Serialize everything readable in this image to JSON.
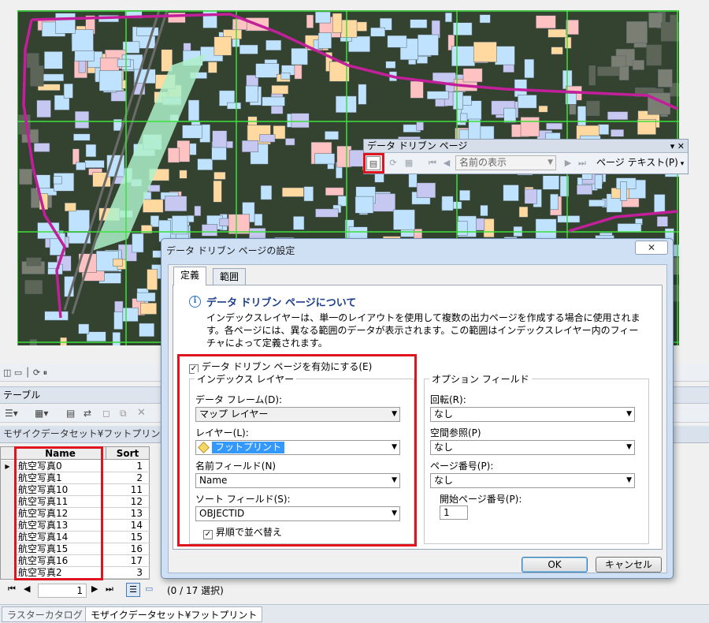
{
  "toolbar": {
    "title": "データ ドリブン ページ",
    "controls": "▾ ✕",
    "page_name_placeholder": "名前の表示",
    "page_text_label": "ページ テキスト(P)"
  },
  "table_window": {
    "title": "テーブル",
    "layer_tab": "モザイクデータセット¥フットプリン",
    "columns": [
      "Name",
      "Sort"
    ],
    "rows": [
      {
        "name": "航空写真0",
        "sort": "1"
      },
      {
        "name": "航空写真1",
        "sort": "2"
      },
      {
        "name": "航空写真10",
        "sort": "11"
      },
      {
        "name": "航空写真11",
        "sort": "12"
      },
      {
        "name": "航空写真12",
        "sort": "13"
      },
      {
        "name": "航空写真13",
        "sort": "14"
      },
      {
        "name": "航空写真14",
        "sort": "15"
      },
      {
        "name": "航空写真15",
        "sort": "16"
      },
      {
        "name": "航空写真16",
        "sort": "17"
      },
      {
        "name": "航空写真2",
        "sort": "3"
      }
    ],
    "current_record": "1",
    "selection_status": "(0 / 17 選択)",
    "bottom_tabs": [
      "ラスターカタログ",
      "モザイクデータセット¥フットプリント"
    ]
  },
  "dialog": {
    "title": "データ ドリブン ページの設定",
    "close": "✕",
    "tabs": [
      "定義",
      "範囲"
    ],
    "info_title": "データ ドリブン ページについて",
    "info_text": "インデックスレイヤーは、単一のレイアウトを使用して複数の出力ページを作成する場合に使用されます。各ページには、異なる範囲のデータが表示されます。この範囲はインデックスレイヤー内のフィーチャによって定義されます。",
    "enable_label": "データ ドリブン ページを有効にする(E)",
    "index_group": "インデックス レイヤー",
    "data_frame_label": "データ フレーム(D):",
    "data_frame_value": "マップ レイヤー",
    "layer_label": "レイヤー(L):",
    "layer_value": "フットプリント",
    "name_field_label": "名前フィールド(N)",
    "name_field_value": "Name",
    "sort_field_label": "ソート フィールド(S):",
    "sort_field_value": "OBJECTID",
    "ascending_label": "昇順で並べ替え",
    "options_group": "オプション フィールド",
    "rotation_label": "回転(R):",
    "rotation_value": "なし",
    "spatial_ref_label": "空間参照(P)",
    "spatial_ref_value": "なし",
    "page_number_label": "ページ番号(P):",
    "page_number_value": "なし",
    "start_page_label": "開始ページ番号(P):",
    "start_page_value": "1",
    "ok_label": "OK",
    "cancel_label": "キャンセル"
  },
  "colors": {
    "highlight_red": "#e0141e",
    "boundary_magenta": "#c21f9b",
    "grid_green": "#3ce03c",
    "building_blue": "#bfe3ff"
  }
}
